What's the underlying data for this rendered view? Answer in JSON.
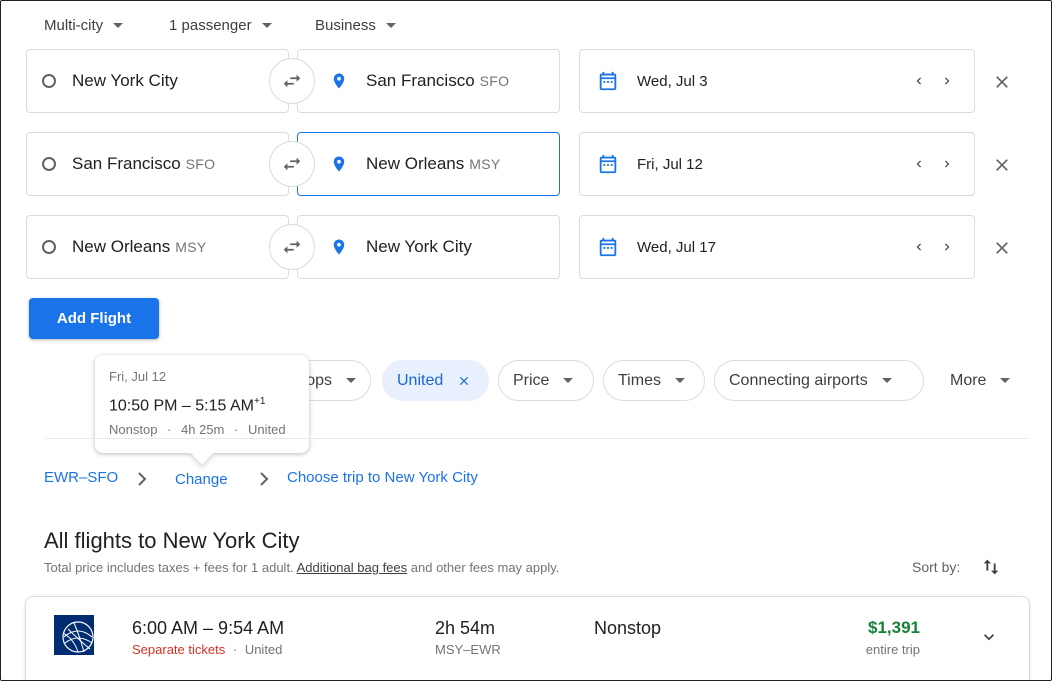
{
  "search_options": {
    "trip_type": "Multi-city",
    "passengers": "1 passenger",
    "cabin_class": "Business"
  },
  "legs": [
    {
      "origin": "New York City",
      "origin_code": "",
      "destination": "San Francisco",
      "destination_code": "SFO",
      "date": "Wed, Jul 3"
    },
    {
      "origin": "San Francisco",
      "origin_code": "SFO",
      "destination": "New Orleans",
      "destination_code": "MSY",
      "date": "Fri, Jul 12"
    },
    {
      "origin": "New Orleans",
      "origin_code": "MSY",
      "destination": "New York City",
      "destination_code": "",
      "date": "Wed, Jul 17"
    }
  ],
  "add_flight_label": "Add Flight",
  "filters": {
    "stops_label": "ops",
    "airline_label": "United",
    "price_label": "Price",
    "times_label": "Times",
    "connecting_label": "Connecting airports",
    "more_label": "More"
  },
  "tooltip": {
    "date": "Fri, Jul 12",
    "time": "10:50 PM – 5:15 AM",
    "day_offset": "+1",
    "stops": "Nonstop",
    "duration": "4h 25m",
    "airline": "United"
  },
  "breadcrumb": {
    "leg1": "EWR–SFO",
    "leg2": "Change",
    "leg3": "Choose trip to New York City"
  },
  "results": {
    "title": "All flights to New York City",
    "subtitle_prefix": "Total price includes taxes + fees for 1 adult. ",
    "bag_fees_link": "Additional bag fees",
    "subtitle_suffix": " and other fees may apply.",
    "sort_label": "Sort by:"
  },
  "flight": {
    "times": "6:00 AM – 9:54 AM",
    "ticket_note": "Separate tickets",
    "airline": "United",
    "duration": "2h 54m",
    "route": "MSY–EWR",
    "stops": "Nonstop",
    "price": "$1,391",
    "price_note": "entire trip"
  },
  "colors": {
    "accent": "#1a73e8",
    "price_green": "#188038",
    "separate_red": "#d93025",
    "chip_selected_bg": "#e8f0fe",
    "airline_logo": "#002d72"
  }
}
